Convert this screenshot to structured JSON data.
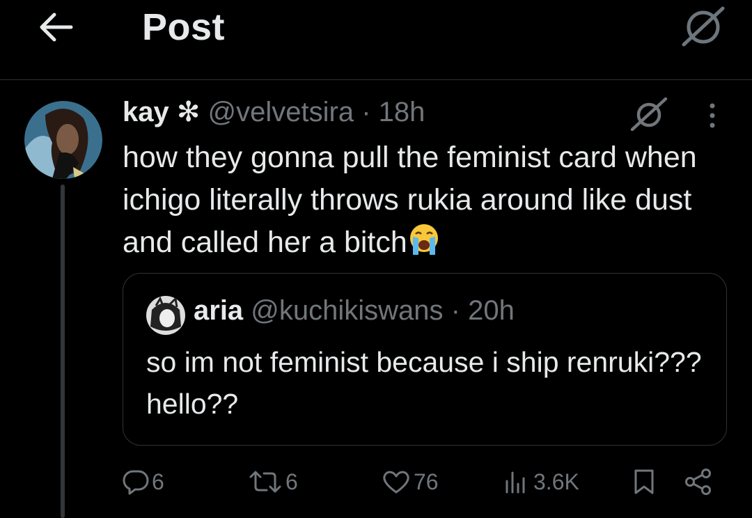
{
  "header": {
    "title": "Post"
  },
  "post": {
    "author_name": "kay",
    "author_badge": "✻",
    "handle": "@velvetsira",
    "separator": "·",
    "time": "18h",
    "text": "how they gonna pull the feminist card when ichigo literally throws rukia around like dust and called her a bitch",
    "emoji": "loudly-crying-face"
  },
  "quote": {
    "author_name": "aria",
    "handle": "@kuchikiswans",
    "separator": "·",
    "time": "20h",
    "text": "so im not feminist because i ship renruki??? hello??"
  },
  "actions": {
    "replies": "6",
    "reposts": "6",
    "likes": "76",
    "views": "3.6K"
  },
  "colors": {
    "background": "#000000",
    "text": "#e7e9ea",
    "muted": "#71767b",
    "border": "#2f3336"
  }
}
